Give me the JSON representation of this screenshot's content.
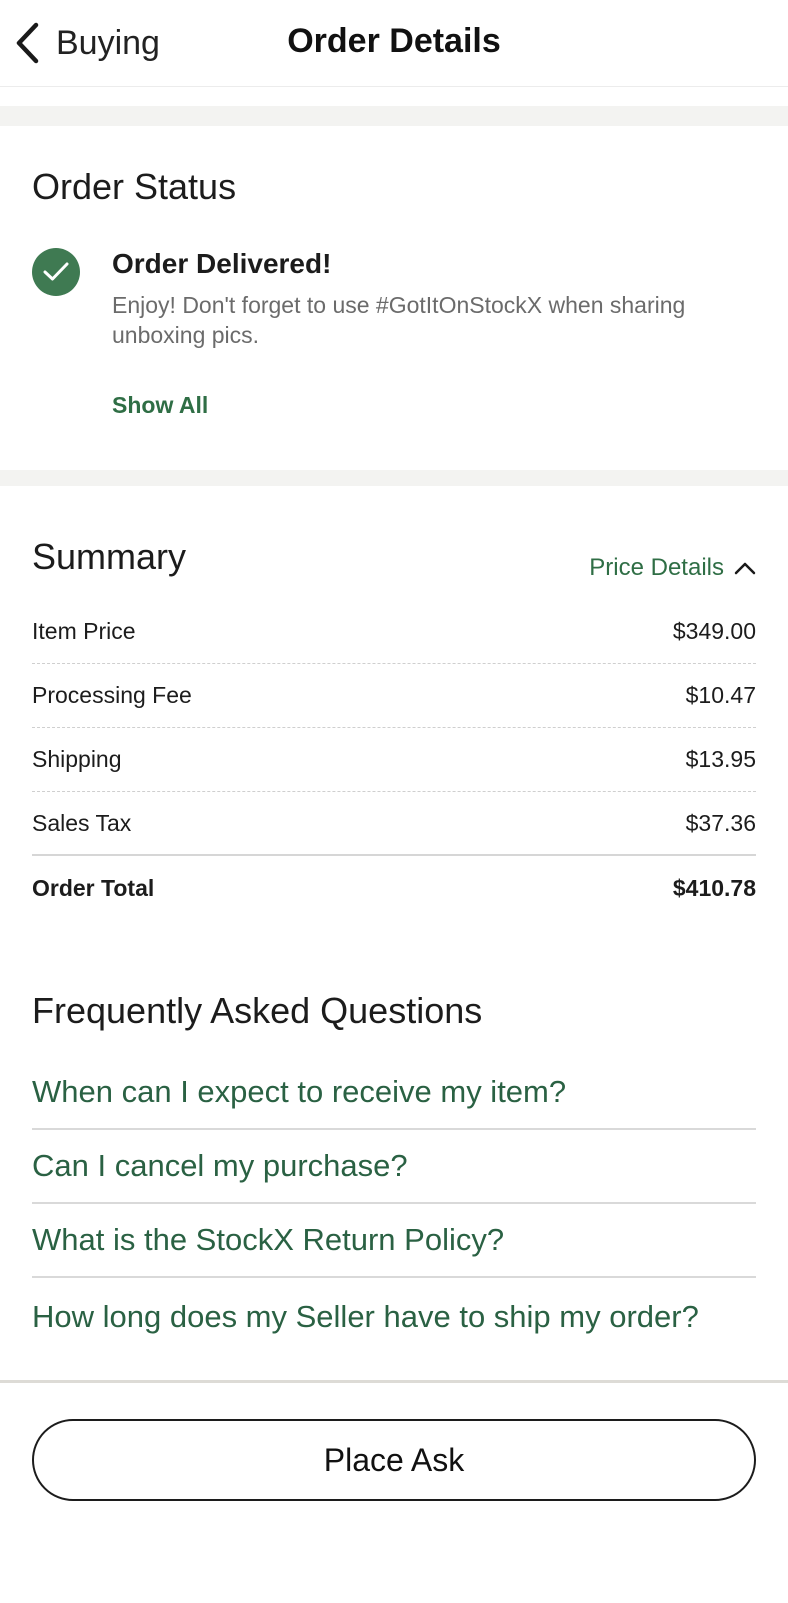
{
  "header": {
    "back_label": "Buying",
    "title": "Order Details"
  },
  "order_status": {
    "title": "Order Status",
    "status_heading": "Order Delivered!",
    "status_description": "Enjoy! Don't forget to use #GotItOnStockX when sharing unboxing pics.",
    "show_all_label": "Show All",
    "status_icon": "check-circle-icon"
  },
  "summary": {
    "title": "Summary",
    "price_details_label": "Price Details",
    "rows": [
      {
        "label": "Item Price",
        "value": "$349.00"
      },
      {
        "label": "Processing Fee",
        "value": "$10.47"
      },
      {
        "label": "Shipping",
        "value": "$13.95"
      },
      {
        "label": "Sales Tax",
        "value": "$37.36"
      }
    ],
    "total": {
      "label": "Order Total",
      "value": "$410.78"
    }
  },
  "faq": {
    "title": "Frequently Asked Questions",
    "items": [
      "When can I expect to receive my item?",
      "Can I cancel my purchase?",
      "What is the StockX Return Policy?",
      "How long does my Seller have to ship my order?"
    ]
  },
  "footer": {
    "place_ask_label": "Place Ask"
  },
  "colors": {
    "accent_green": "#2f6e45",
    "check_green": "#3f7a52",
    "band_gray": "#f3f3f1"
  }
}
